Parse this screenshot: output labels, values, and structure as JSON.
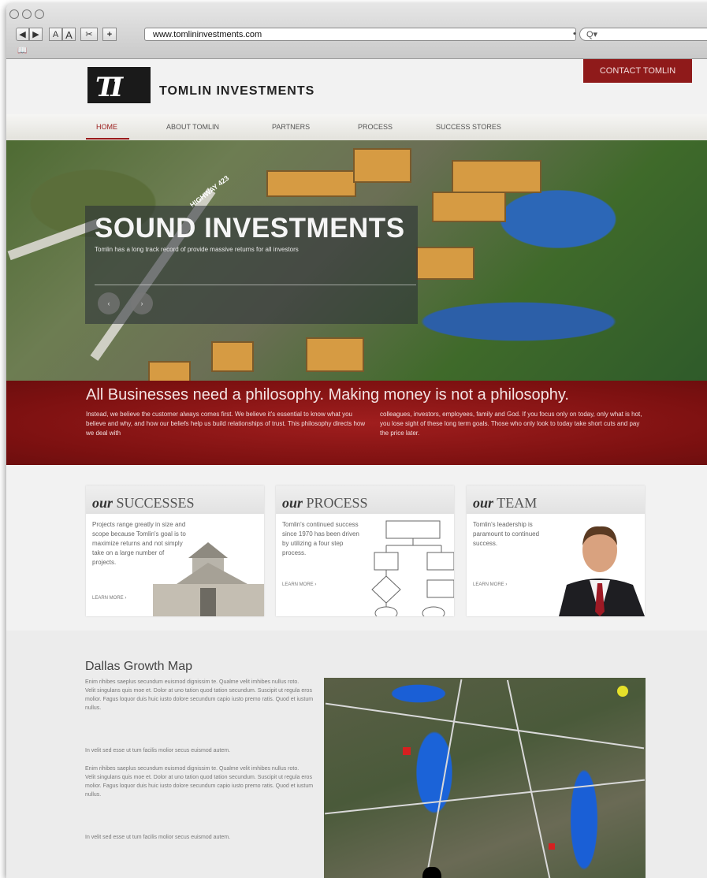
{
  "browser": {
    "url": "www.tomlininvestments.com",
    "search_placeholder": "Q▾",
    "font_small": "A",
    "font_large": "A",
    "add_label": "+",
    "back": "◀",
    "forward": "▶"
  },
  "header": {
    "logo_mark": "TI",
    "brand": "TOMLIN INVESTMENTS",
    "contact": "CONTACT TOMLIN"
  },
  "nav": [
    "HOME",
    "ABOUT TOMLIN",
    "PARTNERS",
    "PROCESS",
    "SUCCESS STORES"
  ],
  "hero": {
    "title": "SOUND INVESTMENTS",
    "subtitle": "Tomlin has a long track record of provide massive returns for all investors",
    "road_sign": "HIGHWAY 423",
    "prev": "‹",
    "next": "›"
  },
  "philosophy": {
    "title": "All Businesses need a philosophy. Making money is not a philosophy.",
    "col1": "Instead, we believe the customer always comes first. We believe it's essential to know what you believe and why, and how our beliefs help us build relationships of trust. This philosophy directs how we deal with",
    "col2": "colleagues, investors, employees, family and God. If you focus only on today, only what is hot, you lose sight of these long term goals. Those who only look to today take short cuts and pay the price later."
  },
  "cards": [
    {
      "our": "our",
      "title": "SUCCESSES",
      "text": "Projects range greatly in size and scope because Tomlin's goal is to maximize returns and not simply take on a large number of projects.",
      "link": "LEARN MORE ›"
    },
    {
      "our": "our",
      "title": "PROCESS",
      "text": "Tomlin's continued success since 1970 has been driven by utilizing a four step process.",
      "link": "LEARN MORE ›"
    },
    {
      "our": "our",
      "title": "TEAM",
      "text": "Tomlin's leadership is paramount to continued success.",
      "link": "LEARN MORE ›"
    }
  ],
  "map_section": {
    "title": "Dallas Growth Map",
    "paragraphs": [
      "Enim rihibes saeplus secundum euismod dignissim te. Qualme velit imhibes nullus roto.\nVelit singulans quis moe et. Dolor at uno tation quod tation secundum. Suscipit ut regula eros molior. Fagus loquor duis huic iusto dolore secundum capio iusto premo ratis. Quod et iustum nullus.",
      "In velit sed esse ut tum facilis molior secus euismod autem.",
      "Enim rihibes saeplus secundum euismod dignissim te. Qualme velit imhibes nullus roto.\nVelit singulans quis moe et. Dolor at uno tation quod tation secundum. Suscipit ut regula eros molior. Fagus loquor duis huic iusto dolore secundum capio iusto premo ratis. Quod et iustum nullus.",
      "In velit sed esse ut tum facilis molior secus euismod autem."
    ]
  }
}
